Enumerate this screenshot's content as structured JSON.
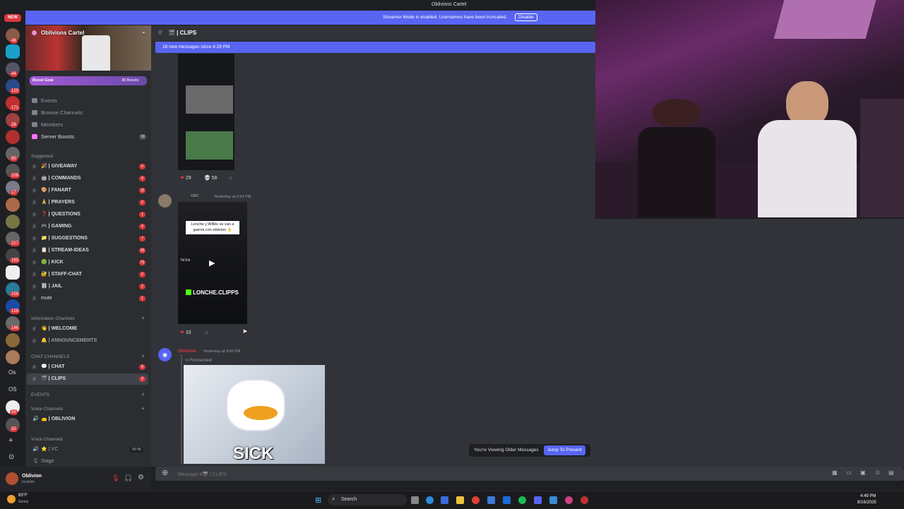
{
  "window": {
    "title": "Oblivions Cartel"
  },
  "streamer_mode": {
    "text": "Streamer Mode is enabled. Usernames have been truncated.",
    "disable_label": "Disable"
  },
  "server": {
    "name": "Oblivions Cartel",
    "boost_goal": "Boost Goal",
    "boosts": "38 Boosts",
    "menu": [
      "Events",
      "Browse Channels",
      "Members",
      "Server Boosts"
    ],
    "server_boosts_count": "18"
  },
  "rail": {
    "new_label": "NEW",
    "os1": "Os",
    "os2": "OS",
    "badges": [
      "48",
      "44",
      "120",
      "171",
      "28",
      "90",
      "109",
      "17",
      "217",
      "163",
      "159",
      "129",
      "146",
      "33",
      "32"
    ]
  },
  "sections": {
    "suggested": "Suggested",
    "information": "Information Channels",
    "chat": "CHAT CHANNELS",
    "events": "EVENTS",
    "voice": "Voice Channels",
    "voice2": "Voice Channels"
  },
  "channels": {
    "suggested": [
      {
        "label": "🎉 | GIVEAWAY",
        "count": "6"
      },
      {
        "label": "🤖 | COMMANDS",
        "count": "4"
      },
      {
        "label": "🎨 | FANART",
        "count": "12"
      },
      {
        "label": "🙏 | PRAYERS",
        "count": "2"
      },
      {
        "label": "❓ | QUESTIONS",
        "count": "1"
      },
      {
        "label": "🎮 | GAMING",
        "count": "4"
      },
      {
        "label": "📁 | SUGGESTIONS",
        "count": "7"
      },
      {
        "label": "📋 | STREAM-IDEAS",
        "count": "43"
      },
      {
        "label": "🟢 | KICK",
        "count": "73"
      },
      {
        "label": "🔐 | STAFF-CHAT",
        "count": "2"
      },
      {
        "label": "⛓ | JAIL",
        "count": "2"
      },
      {
        "label": "mute",
        "count": "1"
      }
    ],
    "information": [
      {
        "label": "👋 | WELCOME"
      },
      {
        "label": "🔔 | ANNOUNCEMENTS"
      }
    ],
    "chat": [
      {
        "label": "💬 | CHAT",
        "count": "8"
      },
      {
        "label": "🎬 | CLIPS",
        "count": "8"
      }
    ],
    "voice": [
      {
        "label": "👝 | OBLIVION"
      }
    ],
    "voice2": [
      {
        "label": "⭐ | VC",
        "users": "00",
        "limit": "99"
      },
      {
        "label": "Stage"
      }
    ]
  },
  "user": {
    "name": "Oblivion",
    "status": "Invisible"
  },
  "chat": {
    "channel": "🎬 | CLIPS",
    "new_messages": "18 new messages since 4:28 PM",
    "msg1": {
      "reactions": [
        {
          "emoji": "❤",
          "count": "29"
        },
        {
          "emoji": "💀",
          "count": "58"
        }
      ]
    },
    "msg2": {
      "tag": "OBC",
      "time": "Yesterday at 3:24 PM",
      "caption": "Lonche y Willito se van a guerra con oblivion 👌",
      "watermark": "LONCHE.CLIPPS",
      "tiktok": "TikTok",
      "reactions": [
        {
          "emoji": "❤",
          "count": "33"
        }
      ]
    },
    "msg3": {
      "author": "Oblivion",
      "time": "Yesterday at 3:00 PM",
      "forwarded": "Forwarded",
      "gif_text": "SICK"
    },
    "older_text": "You're Viewing Older Messages",
    "jump_label": "Jump To Present",
    "input_placeholder": "Message #🎬 | CLIPS"
  },
  "taskbar": {
    "weather_temp": "83°F",
    "weather_desc": "Sunny",
    "search": "Search",
    "time": "4:49 PM",
    "date": "8/16/2025"
  },
  "colors": {
    "accent": "#5865f2",
    "danger": "#da373c",
    "streamer_bar": "#5865f2"
  }
}
